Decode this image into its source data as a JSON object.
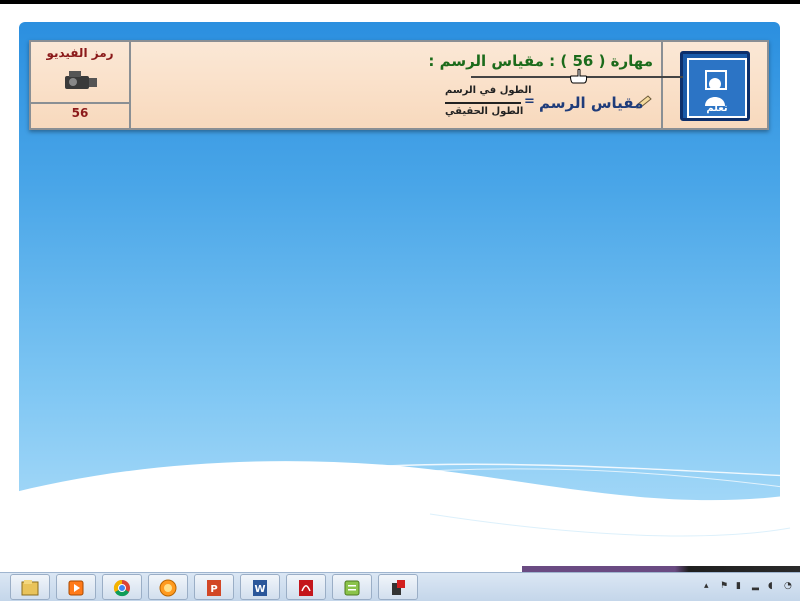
{
  "slide": {
    "skill_heading": {
      "prefix": "مهارة (",
      "number": "56",
      "suffix": ") : مقياس الرسم :"
    },
    "formula": {
      "label": "مقياس الرسم",
      "equals": "=",
      "numerator": "الطول في الرسم",
      "denominator": "الطول الحقيقي"
    },
    "logo": {
      "caption": "تعلم",
      "icon": "learn-logo-icon"
    },
    "video_box": {
      "label": "رمز الفيديو",
      "number": "56",
      "icon": "video-camera-icon"
    },
    "colors": {
      "slide_blue": "#2b8fdf",
      "header_fill": "#fbe8d6",
      "title_green": "#1b6b1b",
      "video_red": "#8b1a1a",
      "formula_blue": "#1f3c7a"
    }
  },
  "taskbar": {
    "apps": [
      {
        "name": "file-manager-icon"
      },
      {
        "name": "media-player-icon"
      },
      {
        "name": "chrome-icon"
      },
      {
        "name": "browser-orange-icon"
      },
      {
        "name": "powerpoint-icon"
      },
      {
        "name": "word-icon"
      },
      {
        "name": "pdf-reader-icon"
      },
      {
        "name": "notes-app-icon"
      },
      {
        "name": "camera-app-icon"
      }
    ],
    "tray": [
      {
        "name": "tray-arrow-icon",
        "glyph": "▴"
      },
      {
        "name": "flag-icon",
        "glyph": "⚑"
      },
      {
        "name": "network-icon",
        "glyph": "▮"
      },
      {
        "name": "signal-icon",
        "glyph": "▂"
      },
      {
        "name": "volume-icon",
        "glyph": "◖"
      },
      {
        "name": "clock-icon",
        "glyph": "◔"
      }
    ]
  }
}
